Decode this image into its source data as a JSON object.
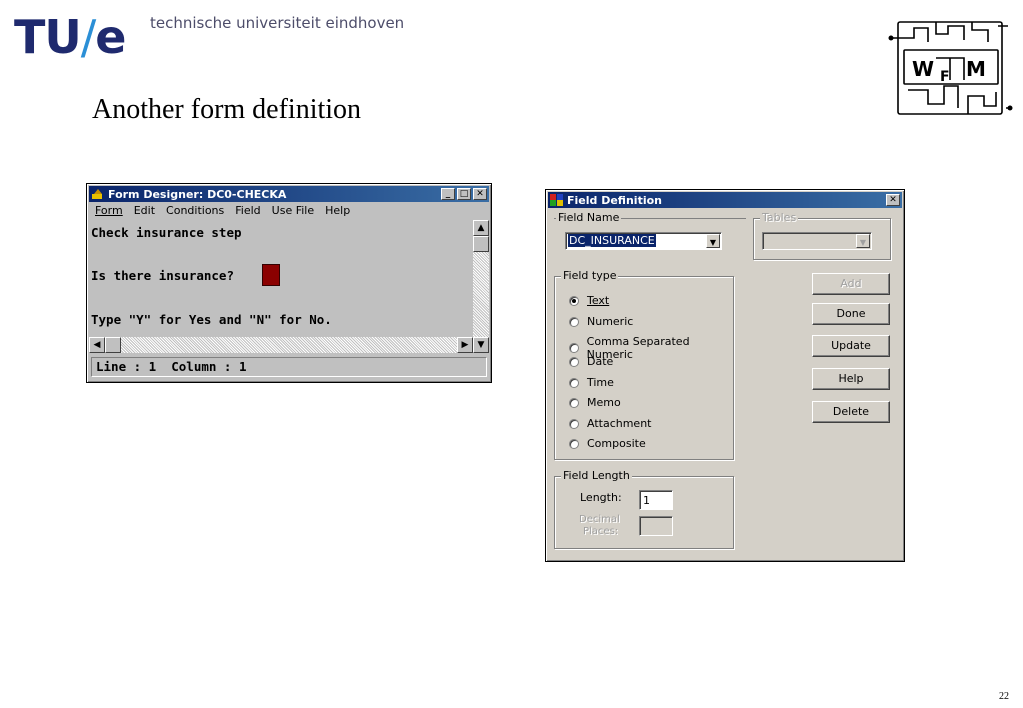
{
  "header": {
    "logo_tu": "TU",
    "logo_slash": "/",
    "logo_e": "e",
    "university": "technische universiteit eindhoven",
    "slide_title": "Another form definition",
    "page_number": "22"
  },
  "wfm_logo": {
    "text_w": "W",
    "text_f": "F",
    "text_m": "M"
  },
  "form_designer": {
    "title": "Form Designer: DC0-CHECKA",
    "menu": [
      "Form",
      "Edit",
      "Conditions",
      "Field",
      "Use File",
      "Help"
    ],
    "lines": [
      "Check insurance step",
      "Is there insurance?",
      "Type \"Y\" for Yes and \"N\" for No."
    ],
    "status": "Line : 1  Column : 1"
  },
  "field_definition": {
    "title": "Field Definition",
    "field_name_label": "Field Name",
    "field_name_value": "DC_INSURANCE",
    "tables_label": "Tables",
    "field_type_label": "Field type",
    "types": [
      "Text",
      "Numeric",
      "Comma Separated Numeric",
      "Date",
      "Time",
      "Memo",
      "Attachment",
      "Composite"
    ],
    "selected_type": "Text",
    "buttons": {
      "add": "Add",
      "done": "Done",
      "update": "Update",
      "help": "Help",
      "delete": "Delete"
    },
    "field_length_label": "Field Length",
    "length_label": "Length:",
    "length_value": "1",
    "decimal_label_1": "Decimal",
    "decimal_label_2": "Places:"
  },
  "colors": {
    "titlebar_start": "#0a246a",
    "titlebar_end": "#3a6ea5",
    "window_face": "#c0c0c0",
    "dialog_face": "#d4d0c8",
    "logo_blue": "#1f2a6e",
    "logo_slash": "#2b8fd6",
    "insurance_field": "#8b0000"
  }
}
